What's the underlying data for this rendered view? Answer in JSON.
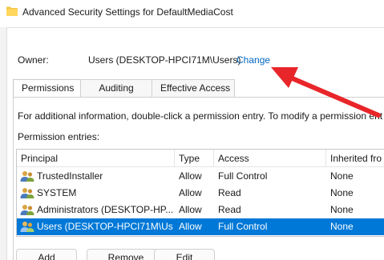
{
  "window": {
    "title": "Advanced Security Settings for DefaultMediaCost"
  },
  "owner": {
    "label": "Owner:",
    "value": "Users (DESKTOP-HPCI71M\\Users)",
    "change_link": "Change"
  },
  "tabs": [
    {
      "label": "Permissions",
      "active": true
    },
    {
      "label": "Auditing",
      "active": false
    },
    {
      "label": "Effective Access",
      "active": false
    }
  ],
  "info_text": "For additional information, double-click a permission entry. To modify a permission ent",
  "entries_label": "Permission entries:",
  "table": {
    "headers": [
      "Principal",
      "Type",
      "Access",
      "Inherited fro"
    ],
    "rows": [
      {
        "principal": "TrustedInstaller",
        "type": "Allow",
        "access": "Full Control",
        "inherited": "None",
        "selected": false
      },
      {
        "principal": "SYSTEM",
        "type": "Allow",
        "access": "Read",
        "inherited": "None",
        "selected": false
      },
      {
        "principal": "Administrators (DESKTOP-HP...",
        "type": "Allow",
        "access": "Read",
        "inherited": "None",
        "selected": false
      },
      {
        "principal": "Users (DESKTOP-HPCI71M\\Us...",
        "type": "Allow",
        "access": "Full Control",
        "inherited": "None",
        "selected": true
      }
    ]
  },
  "buttons": {
    "add": "Add",
    "remove": "Remove",
    "edit": "Edit"
  },
  "colors": {
    "accent": "#0067c0",
    "selection": "#0078d7",
    "annotation_arrow": "#e8262a"
  },
  "icons": {
    "title": "folder-icon",
    "principal": "users-icon",
    "annotation": "red-arrow-icon"
  }
}
